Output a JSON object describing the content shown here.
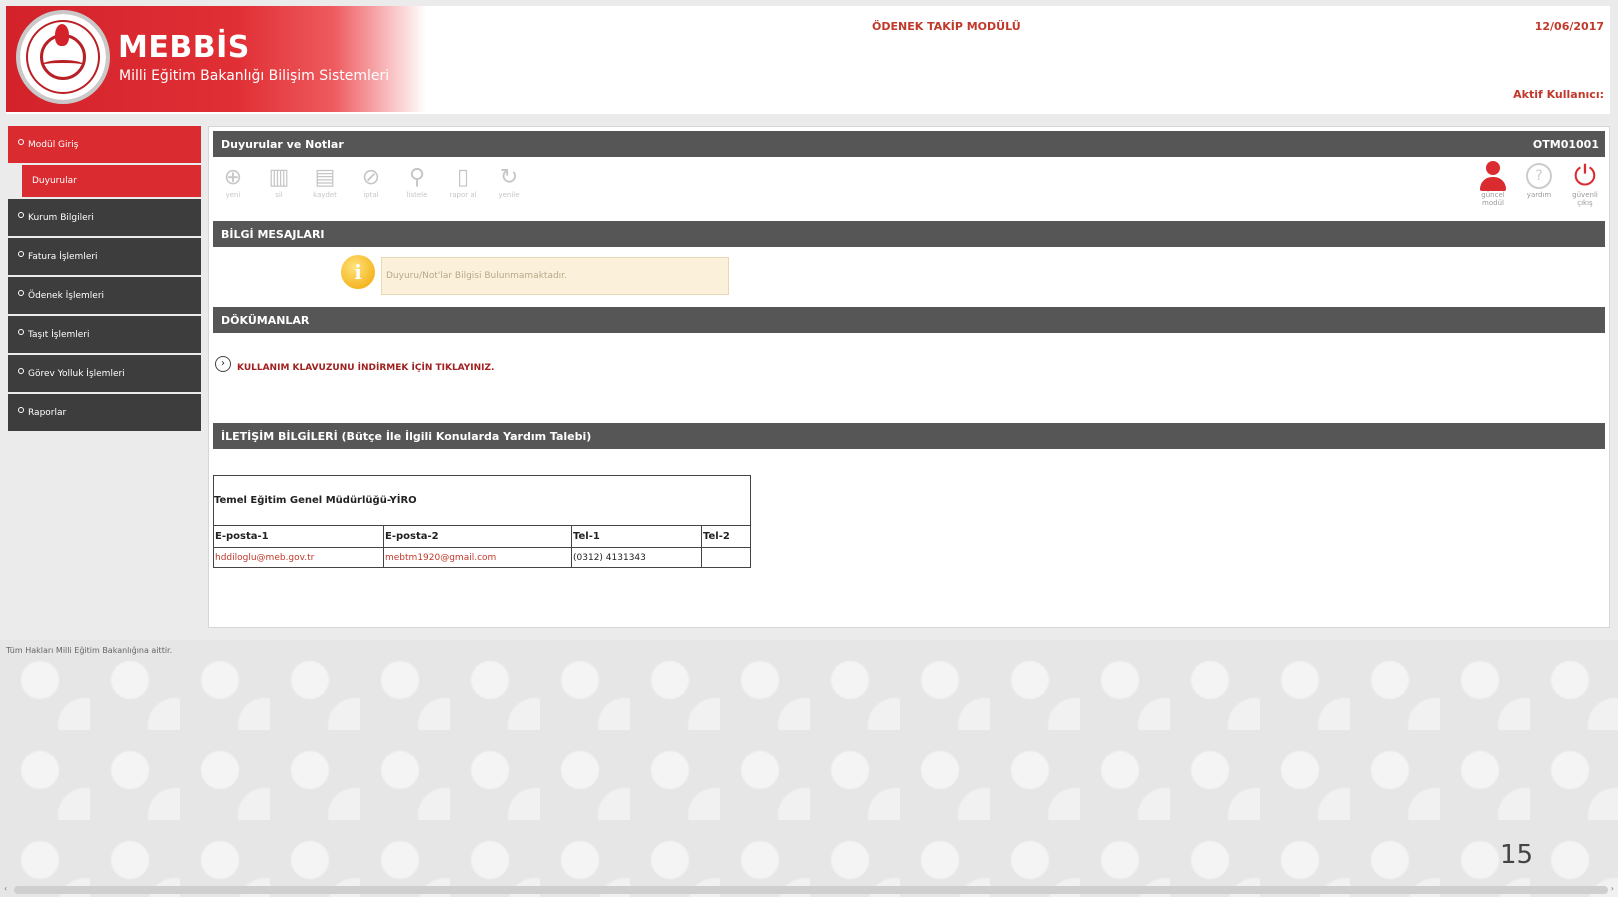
{
  "header": {
    "brand_title": "MEBBİS",
    "brand_subtitle": "Milli Eğitim Bakanlığı Bilişim Sistemleri",
    "module_title": "ÖDENEK TAKİP MODÜLÜ",
    "date": "12/06/2017",
    "active_user_label": "Aktif Kullanıcı:"
  },
  "sidebar": {
    "items": [
      {
        "label": "Modül Giriş"
      },
      {
        "label": "Duyurular"
      },
      {
        "label": "Kurum Bilgileri"
      },
      {
        "label": "Fatura İşlemleri"
      },
      {
        "label": "Ödenek İşlemleri"
      },
      {
        "label": "Taşıt İşlemleri"
      },
      {
        "label": "Görev Yolluk İşlemleri"
      },
      {
        "label": "Raporlar"
      }
    ]
  },
  "copyright": "Tüm Hakları Milli Eğitim Bakanlığına aittir.",
  "main": {
    "panel_title": "Duyurular ve Notlar",
    "panel_code": "OTM01001",
    "toolbar": [
      {
        "label": "yeni",
        "icon": "add-icon"
      },
      {
        "label": "sil",
        "icon": "delete-icon"
      },
      {
        "label": "kaydet",
        "icon": "save-icon"
      },
      {
        "label": "iptal",
        "icon": "cancel-icon"
      },
      {
        "label": "listele",
        "icon": "search-icon"
      },
      {
        "label": "rapor al",
        "icon": "report-icon"
      },
      {
        "label": "yenile",
        "icon": "refresh-icon"
      }
    ],
    "right_tools": [
      {
        "label": "güncel modül",
        "icon": "user-icon"
      },
      {
        "label": "yardım",
        "icon": "help-icon"
      },
      {
        "label": "güvenli çıkış",
        "icon": "power-icon"
      }
    ],
    "info_section_title": "BİLGİ MESAJLARI",
    "info_message": "Duyuru/Not'lar Bilgisi Bulunmamaktadır.",
    "docs_section_title": "DÖKÜMANLAR",
    "docs_link": "KULLANIM KLAVUZUNU İNDİRMEK İÇİN TIKLAYINIZ.",
    "contact_section_title": "İLETİŞİM BİLGİLERİ (Bütçe İle İlgili Konularda Yardım Talebi)",
    "contact": {
      "title": "Temel Eğitim Genel Müdürlüğü-YİRO",
      "headers": [
        "E-posta-1",
        "E-posta-2",
        "Tel-1",
        "Tel-2"
      ],
      "row": [
        "hddiloglu@meb.gov.tr",
        "mebtm1920@gmail.com",
        "(0312) 4131343",
        ""
      ]
    }
  },
  "page_number": "15"
}
